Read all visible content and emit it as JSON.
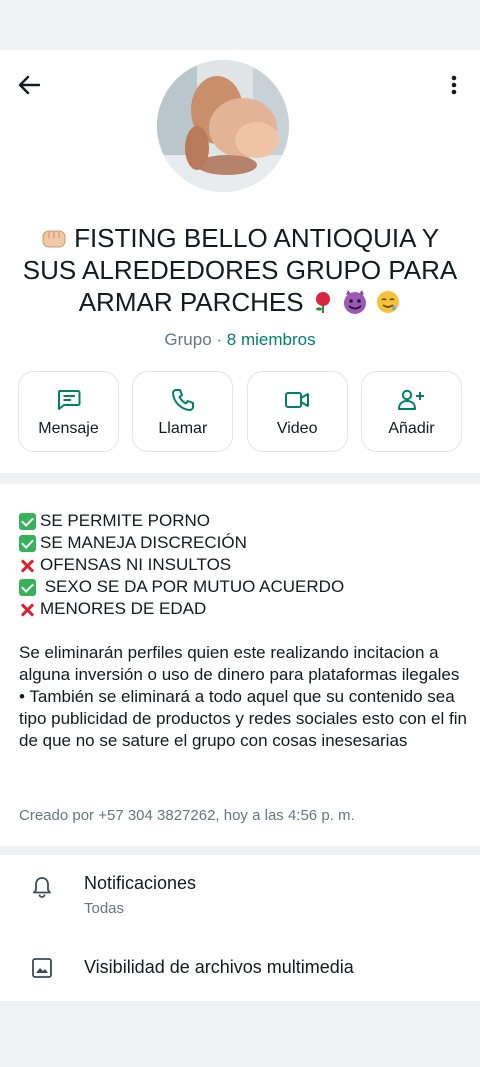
{
  "header": {
    "back_icon": "arrow-left-icon",
    "menu_icon": "more-vert-icon",
    "avatar_icon": "group-avatar",
    "title_emoji_start": "fist-emoji",
    "title": "FISTING BELLO ANTIOQUIA Y SUS ALREDEDORES GRUPO PARA ARMAR PARCHES",
    "title_emoji_end": [
      "rose-emoji",
      "smiling-devil-emoji",
      "drooling-face-emoji"
    ],
    "subtitle_kind": "Grupo",
    "subtitle_sep": " · ",
    "subtitle_members": "8 miembros"
  },
  "actions": [
    {
      "label": "Mensaje",
      "icon": "message-icon"
    },
    {
      "label": "Llamar",
      "icon": "phone-icon"
    },
    {
      "label": "Video",
      "icon": "video-icon"
    },
    {
      "label": "Añadir",
      "icon": "add-person-icon"
    }
  ],
  "description": {
    "rules": [
      {
        "mark": "check",
        "text": "SE PERMITE PORNO"
      },
      {
        "mark": "check",
        "text": "SE MANEJA DISCRECIÓN"
      },
      {
        "mark": "cross",
        "text": "OFENSAS NI INSULTOS"
      },
      {
        "mark": "check",
        "text": " SEXO SE DA POR MUTUO ACUERDO"
      },
      {
        "mark": "cross",
        "text": "MENORES DE EDAD"
      }
    ],
    "paragraph_1": "Se eliminarán perfiles quien este realizando incitacion a alguna inversión o uso de dinero para plataformas ilegales",
    "paragraph_2": "• También se eliminará a todo aquel que su contenido sea tipo publicidad de productos y redes sociales esto con el fin de que no se sature el grupo con cosas inesesarias",
    "created_by": "Creado por +57 304 3827262, hoy a las 4:56 p. m."
  },
  "settings": {
    "notifications_label": "Notificaciones",
    "notifications_value": "Todas",
    "notifications_icon": "bell-icon",
    "media_label": "Visibilidad de archivos multimedia",
    "media_icon": "image-icon"
  },
  "colors": {
    "accent": "#008069",
    "secondary_text": "#667781",
    "primary_text": "#111b21",
    "background": "#f0f1f2"
  }
}
